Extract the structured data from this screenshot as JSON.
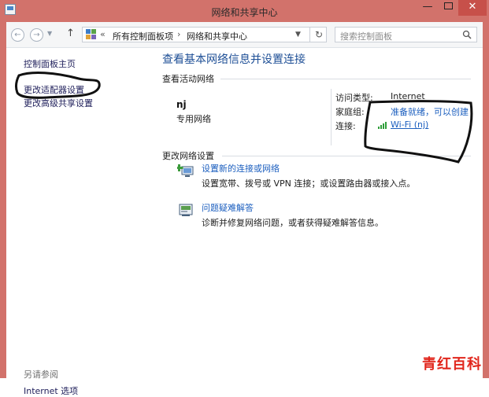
{
  "window": {
    "title": "网络和共享中心",
    "min_label": "—",
    "close_label": "✕",
    "frame_color": "#d2726b",
    "close_color": "#c7504a"
  },
  "nav": {
    "back_icon": "back-arrow-icon",
    "forward_icon": "forward-arrow-icon",
    "up_icon": "up-arrow-icon",
    "address": {
      "chevron": "«",
      "crumbs": [
        "所有控制面板项",
        "网络和共享中心"
      ],
      "separator": "›"
    },
    "search": {
      "placeholder": "搜索控制面板"
    }
  },
  "left_pane": {
    "links": [
      "控制面板主页",
      "更改适配器设置",
      "更改高级共享设置"
    ],
    "see_also_heading": "另请参阅",
    "see_also_links": [
      "Internet 选项"
    ]
  },
  "main": {
    "title": "查看基本网络信息并设置连接",
    "active_networks_heading": "查看活动网络",
    "network": {
      "name": "nj",
      "category": "专用网络",
      "access_type_label": "访问类型:",
      "access_type_value": "Internet",
      "homegroup_label": "家庭组:",
      "homegroup_value": "准备就绪，可以创建",
      "connections_label": "连接:",
      "connection_value": "Wi-Fi (nj)"
    },
    "change_settings_heading": "更改网络设置",
    "tasks": [
      {
        "icon": "new-connection-icon",
        "link": "设置新的连接或网络",
        "description": "设置宽带、拨号或 VPN 连接；或设置路由器或接入点。"
      },
      {
        "icon": "troubleshoot-icon",
        "link": "问题疑难解答",
        "description": "诊断并修复网络问题，或者获得疑难解答信息。"
      }
    ],
    "link_color": "#1c5fbf",
    "title_color": "#1e4f96"
  },
  "watermark": {
    "text": "青红百科",
    "color": "#e1261c"
  }
}
